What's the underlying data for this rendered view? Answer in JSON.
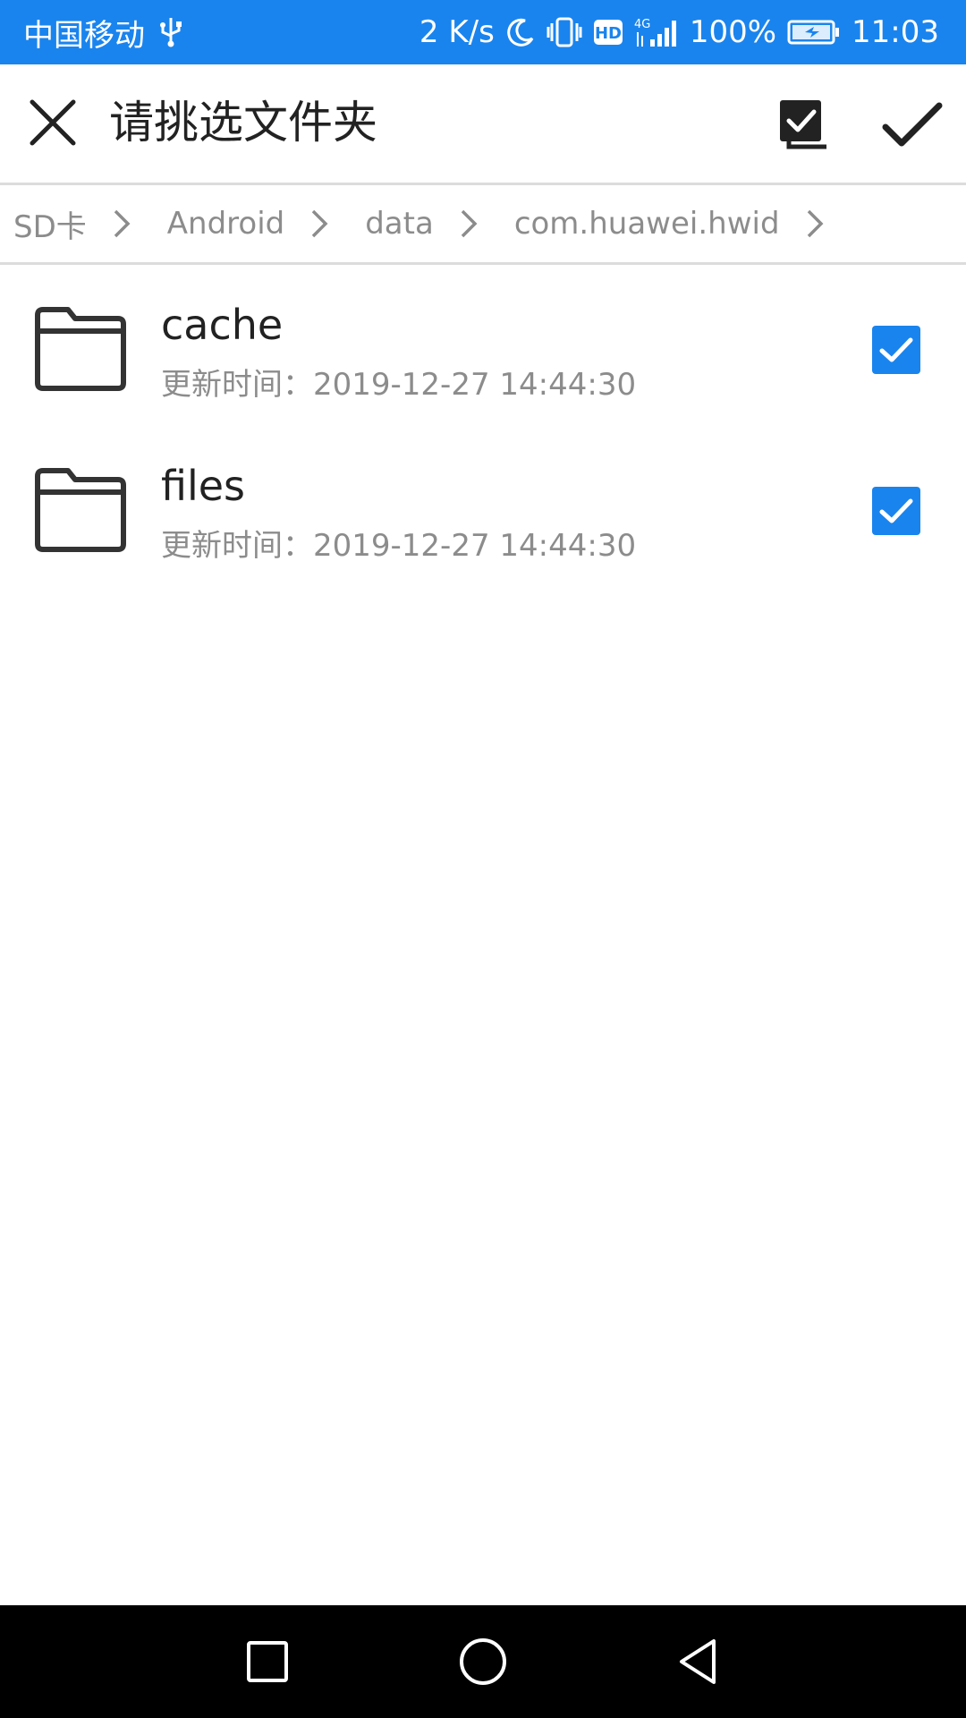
{
  "status_bar": {
    "carrier": "中国移动",
    "net_speed": "2 K/s",
    "hd_badge": "HD",
    "network_type": "4G",
    "battery_percent": "100%",
    "time": "11:03",
    "icons": [
      "usb-icon",
      "moon-icon",
      "vibrate-icon",
      "hd-icon",
      "signal-icon",
      "battery-charging-icon"
    ]
  },
  "toolbar": {
    "title": "请挑选文件夹",
    "icons": [
      "close-icon",
      "select-all-icon",
      "confirm-check-icon"
    ]
  },
  "breadcrumb": {
    "items": [
      "SD卡",
      "Android",
      "data",
      "com.huawei.hwid"
    ]
  },
  "folders": [
    {
      "name": "cache",
      "updated": "更新时间：2019-12-27 14:44:30",
      "checked": true
    },
    {
      "name": "files",
      "updated": "更新时间：2019-12-27 14:44:30",
      "checked": true
    }
  ],
  "colors": {
    "accent": "#1a84ee",
    "text_primary": "#222222",
    "text_secondary": "#8c8c8c"
  },
  "navigation_bar": {
    "icons": [
      "recent-apps-icon",
      "home-icon",
      "back-icon"
    ]
  }
}
